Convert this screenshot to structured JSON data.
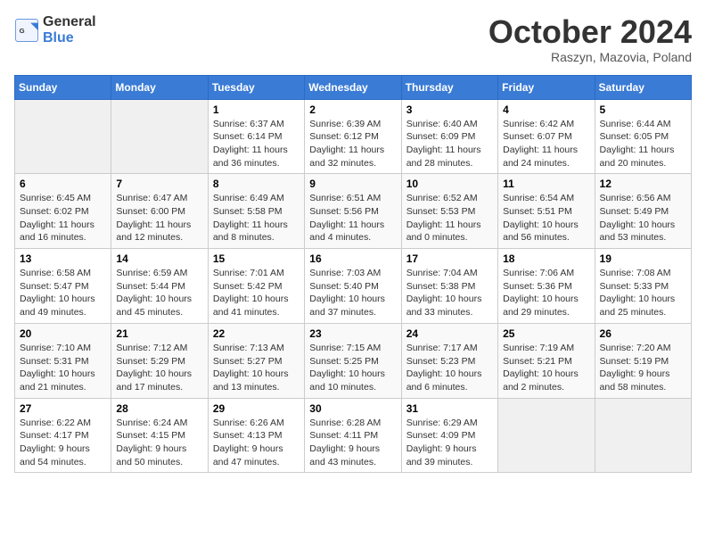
{
  "logo": {
    "general": "General",
    "blue": "Blue"
  },
  "title": "October 2024",
  "location": "Raszyn, Mazovia, Poland",
  "weekdays": [
    "Sunday",
    "Monday",
    "Tuesday",
    "Wednesday",
    "Thursday",
    "Friday",
    "Saturday"
  ],
  "weeks": [
    [
      null,
      null,
      {
        "day": 1,
        "sunrise": "6:37 AM",
        "sunset": "6:14 PM",
        "daylight": "11 hours and 36 minutes."
      },
      {
        "day": 2,
        "sunrise": "6:39 AM",
        "sunset": "6:12 PM",
        "daylight": "11 hours and 32 minutes."
      },
      {
        "day": 3,
        "sunrise": "6:40 AM",
        "sunset": "6:09 PM",
        "daylight": "11 hours and 28 minutes."
      },
      {
        "day": 4,
        "sunrise": "6:42 AM",
        "sunset": "6:07 PM",
        "daylight": "11 hours and 24 minutes."
      },
      {
        "day": 5,
        "sunrise": "6:44 AM",
        "sunset": "6:05 PM",
        "daylight": "11 hours and 20 minutes."
      }
    ],
    [
      {
        "day": 6,
        "sunrise": "6:45 AM",
        "sunset": "6:02 PM",
        "daylight": "11 hours and 16 minutes."
      },
      {
        "day": 7,
        "sunrise": "6:47 AM",
        "sunset": "6:00 PM",
        "daylight": "11 hours and 12 minutes."
      },
      {
        "day": 8,
        "sunrise": "6:49 AM",
        "sunset": "5:58 PM",
        "daylight": "11 hours and 8 minutes."
      },
      {
        "day": 9,
        "sunrise": "6:51 AM",
        "sunset": "5:56 PM",
        "daylight": "11 hours and 4 minutes."
      },
      {
        "day": 10,
        "sunrise": "6:52 AM",
        "sunset": "5:53 PM",
        "daylight": "11 hours and 0 minutes."
      },
      {
        "day": 11,
        "sunrise": "6:54 AM",
        "sunset": "5:51 PM",
        "daylight": "10 hours and 56 minutes."
      },
      {
        "day": 12,
        "sunrise": "6:56 AM",
        "sunset": "5:49 PM",
        "daylight": "10 hours and 53 minutes."
      }
    ],
    [
      {
        "day": 13,
        "sunrise": "6:58 AM",
        "sunset": "5:47 PM",
        "daylight": "10 hours and 49 minutes."
      },
      {
        "day": 14,
        "sunrise": "6:59 AM",
        "sunset": "5:44 PM",
        "daylight": "10 hours and 45 minutes."
      },
      {
        "day": 15,
        "sunrise": "7:01 AM",
        "sunset": "5:42 PM",
        "daylight": "10 hours and 41 minutes."
      },
      {
        "day": 16,
        "sunrise": "7:03 AM",
        "sunset": "5:40 PM",
        "daylight": "10 hours and 37 minutes."
      },
      {
        "day": 17,
        "sunrise": "7:04 AM",
        "sunset": "5:38 PM",
        "daylight": "10 hours and 33 minutes."
      },
      {
        "day": 18,
        "sunrise": "7:06 AM",
        "sunset": "5:36 PM",
        "daylight": "10 hours and 29 minutes."
      },
      {
        "day": 19,
        "sunrise": "7:08 AM",
        "sunset": "5:33 PM",
        "daylight": "10 hours and 25 minutes."
      }
    ],
    [
      {
        "day": 20,
        "sunrise": "7:10 AM",
        "sunset": "5:31 PM",
        "daylight": "10 hours and 21 minutes."
      },
      {
        "day": 21,
        "sunrise": "7:12 AM",
        "sunset": "5:29 PM",
        "daylight": "10 hours and 17 minutes."
      },
      {
        "day": 22,
        "sunrise": "7:13 AM",
        "sunset": "5:27 PM",
        "daylight": "10 hours and 13 minutes."
      },
      {
        "day": 23,
        "sunrise": "7:15 AM",
        "sunset": "5:25 PM",
        "daylight": "10 hours and 10 minutes."
      },
      {
        "day": 24,
        "sunrise": "7:17 AM",
        "sunset": "5:23 PM",
        "daylight": "10 hours and 6 minutes."
      },
      {
        "day": 25,
        "sunrise": "7:19 AM",
        "sunset": "5:21 PM",
        "daylight": "10 hours and 2 minutes."
      },
      {
        "day": 26,
        "sunrise": "7:20 AM",
        "sunset": "5:19 PM",
        "daylight": "9 hours and 58 minutes."
      }
    ],
    [
      {
        "day": 27,
        "sunrise": "6:22 AM",
        "sunset": "4:17 PM",
        "daylight": "9 hours and 54 minutes."
      },
      {
        "day": 28,
        "sunrise": "6:24 AM",
        "sunset": "4:15 PM",
        "daylight": "9 hours and 50 minutes."
      },
      {
        "day": 29,
        "sunrise": "6:26 AM",
        "sunset": "4:13 PM",
        "daylight": "9 hours and 47 minutes."
      },
      {
        "day": 30,
        "sunrise": "6:28 AM",
        "sunset": "4:11 PM",
        "daylight": "9 hours and 43 minutes."
      },
      {
        "day": 31,
        "sunrise": "6:29 AM",
        "sunset": "4:09 PM",
        "daylight": "9 hours and 39 minutes."
      },
      null,
      null
    ]
  ]
}
